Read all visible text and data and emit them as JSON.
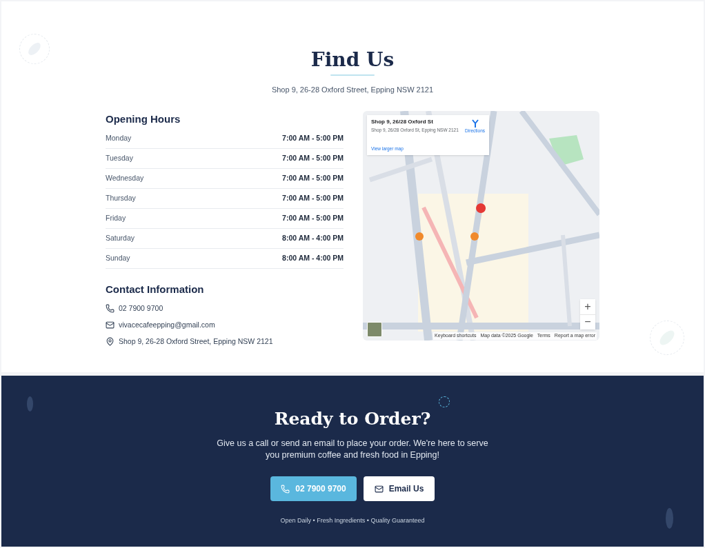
{
  "find_us": {
    "title": "Find Us",
    "address": "Shop 9, 26-28 Oxford Street, Epping NSW 2121"
  },
  "opening_hours": {
    "title": "Opening Hours",
    "rows": [
      {
        "day": "Monday",
        "hours": "7:00 AM - 5:00 PM"
      },
      {
        "day": "Tuesday",
        "hours": "7:00 AM - 5:00 PM"
      },
      {
        "day": "Wednesday",
        "hours": "7:00 AM - 5:00 PM"
      },
      {
        "day": "Thursday",
        "hours": "7:00 AM - 5:00 PM"
      },
      {
        "day": "Friday",
        "hours": "7:00 AM - 5:00 PM"
      },
      {
        "day": "Saturday",
        "hours": "8:00 AM - 4:00 PM"
      },
      {
        "day": "Sunday",
        "hours": "8:00 AM - 4:00 PM"
      }
    ]
  },
  "contact": {
    "title": "Contact Information",
    "items": [
      {
        "kind": "phone",
        "text": "02 7900 9700"
      },
      {
        "kind": "email",
        "text": "vivacecafeepping@gmail.com"
      },
      {
        "kind": "location",
        "text": "Shop 9, 26-28 Oxford Street, Epping NSW 2121"
      }
    ]
  },
  "map": {
    "card": {
      "title": "Shop 9, 26/28 Oxford St",
      "address": "Shop 9, 26/28 Oxford St, Epping NSW 2121",
      "directions": "Directions",
      "larger_map": "View larger map"
    },
    "zoom_in": "+",
    "zoom_out": "−",
    "attribution": [
      "Keyboard shortcuts",
      "Map data ©2025 Google",
      "Terms",
      "Report a map error"
    ]
  },
  "order": {
    "title": "Ready to Order?",
    "text": "Give us a call or send an email to place your order. We're here to serve you premium coffee and fresh food in Epping!",
    "buttons": [
      {
        "kind": "phone",
        "label": "02 7900 9700"
      },
      {
        "kind": "email",
        "label": "Email Us"
      }
    ],
    "tagline": "Open Daily • Fresh Ingredients • Quality Guaranteed"
  }
}
